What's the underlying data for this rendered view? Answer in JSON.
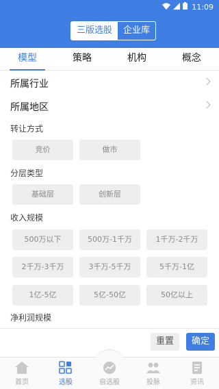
{
  "status_bar": {
    "time": "11:09"
  },
  "header": {
    "segments": [
      {
        "label": "三版选股",
        "active": true
      },
      {
        "label": "企业库",
        "active": false
      }
    ]
  },
  "tabs": [
    "模型",
    "策略",
    "机构",
    "概念"
  ],
  "rows": [
    {
      "label": "所属行业"
    },
    {
      "label": "所属地区"
    }
  ],
  "sections": {
    "transfer": {
      "title": "转让方式",
      "options": [
        "竞价",
        "做市"
      ]
    },
    "tier": {
      "title": "分层类型",
      "options": [
        "基础层",
        "创新层"
      ]
    },
    "revenue": {
      "title": "收入规模",
      "options": [
        "500万以下",
        "500万-1千万",
        "1千万-2千万",
        "2千万-3千万",
        "3千万-5千万",
        "5千万-1亿",
        "1亿-5亿",
        "5亿-50亿",
        "50亿以上"
      ]
    },
    "profit": {
      "title": "净利润规模"
    }
  },
  "actions": {
    "reset": "重置",
    "confirm": "确定"
  },
  "nav": [
    {
      "label": "首页",
      "icon": "home-icon",
      "active": false
    },
    {
      "label": "选股",
      "icon": "grid-icon",
      "active": true
    },
    {
      "label": "自选股",
      "icon": "chart-icon",
      "active": false
    },
    {
      "label": "投脉",
      "icon": "people-icon",
      "active": false
    },
    {
      "label": "资讯",
      "icon": "news-icon",
      "active": false
    }
  ],
  "colors": {
    "accent": "#3f7fe3",
    "option_bg": "#eeeeee"
  }
}
